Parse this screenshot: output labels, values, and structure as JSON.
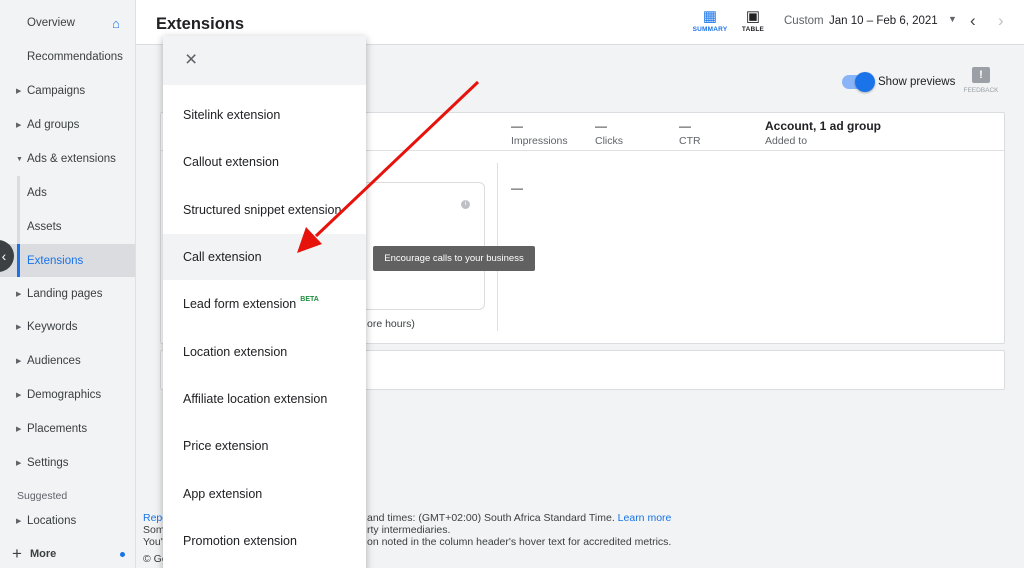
{
  "sidebar": {
    "items": [
      {
        "label": "Overview",
        "has_caret": false
      },
      {
        "label": "Recommendations",
        "has_caret": false
      },
      {
        "label": "Campaigns",
        "has_caret": true
      },
      {
        "label": "Ad groups",
        "has_caret": true
      },
      {
        "label": "Ads & extensions",
        "has_caret": true,
        "expanded": true
      },
      {
        "label": "Ads",
        "sub": true
      },
      {
        "label": "Assets",
        "sub": true
      },
      {
        "label": "Extensions",
        "sub": true,
        "selected": true
      },
      {
        "label": "Landing pages",
        "has_caret": true
      },
      {
        "label": "Keywords",
        "has_caret": true
      },
      {
        "label": "Audiences",
        "has_caret": true
      },
      {
        "label": "Demographics",
        "has_caret": true
      },
      {
        "label": "Placements",
        "has_caret": true
      },
      {
        "label": "Settings",
        "has_caret": true
      }
    ],
    "suggested_label": "Suggested",
    "suggested_item": "Locations",
    "more_label": "More",
    "home_icon": "home-icon",
    "collapse_icon": "chevron-left-icon"
  },
  "header": {
    "title": "Extensions",
    "summary_label": "SUMMARY",
    "table_label": "TABLE",
    "date_custom": "Custom",
    "date_range": "Jan 10 – Feb 6, 2021"
  },
  "toolbar": {
    "show_previews": "Show previews",
    "feedback": "FEEDBACK"
  },
  "card": {
    "impressions_value": "—",
    "impressions_label": "Impressions",
    "clicks_value": "—",
    "clicks_label": "Clicks",
    "ctr_value": "—",
    "ctr_label": "CTR",
    "account_value": "Account, 1 ad group",
    "account_label": "Added to",
    "cell_dash": "—",
    "more_hours": "ore hours)"
  },
  "footer": {
    "line1_left": "Repo",
    "line1_right": "and times: (GMT+02:00) South Africa Standard Time.",
    "learn_more": "Learn more",
    "line2_left": "Som",
    "line2_right": "rty intermediaries.",
    "line3_left": "You'",
    "line3_right": "on noted in the column header's hover text for accredited metrics.",
    "line4_left": "© Go"
  },
  "menu": {
    "items": [
      {
        "label": "Sitelink extension"
      },
      {
        "label": "Callout extension"
      },
      {
        "label": "Structured snippet extension"
      },
      {
        "label": "Call extension",
        "hover": true
      },
      {
        "label": "Lead form extension",
        "badge": "BETA"
      },
      {
        "label": "Location extension"
      },
      {
        "label": "Affiliate location extension"
      },
      {
        "label": "Price extension"
      },
      {
        "label": "App extension"
      },
      {
        "label": "Promotion extension"
      }
    ]
  },
  "tooltip": "Encourage calls to your business",
  "colors": {
    "accent": "#1a73e8",
    "arrow": "#e8120c",
    "beta": "#1e8e3e"
  }
}
